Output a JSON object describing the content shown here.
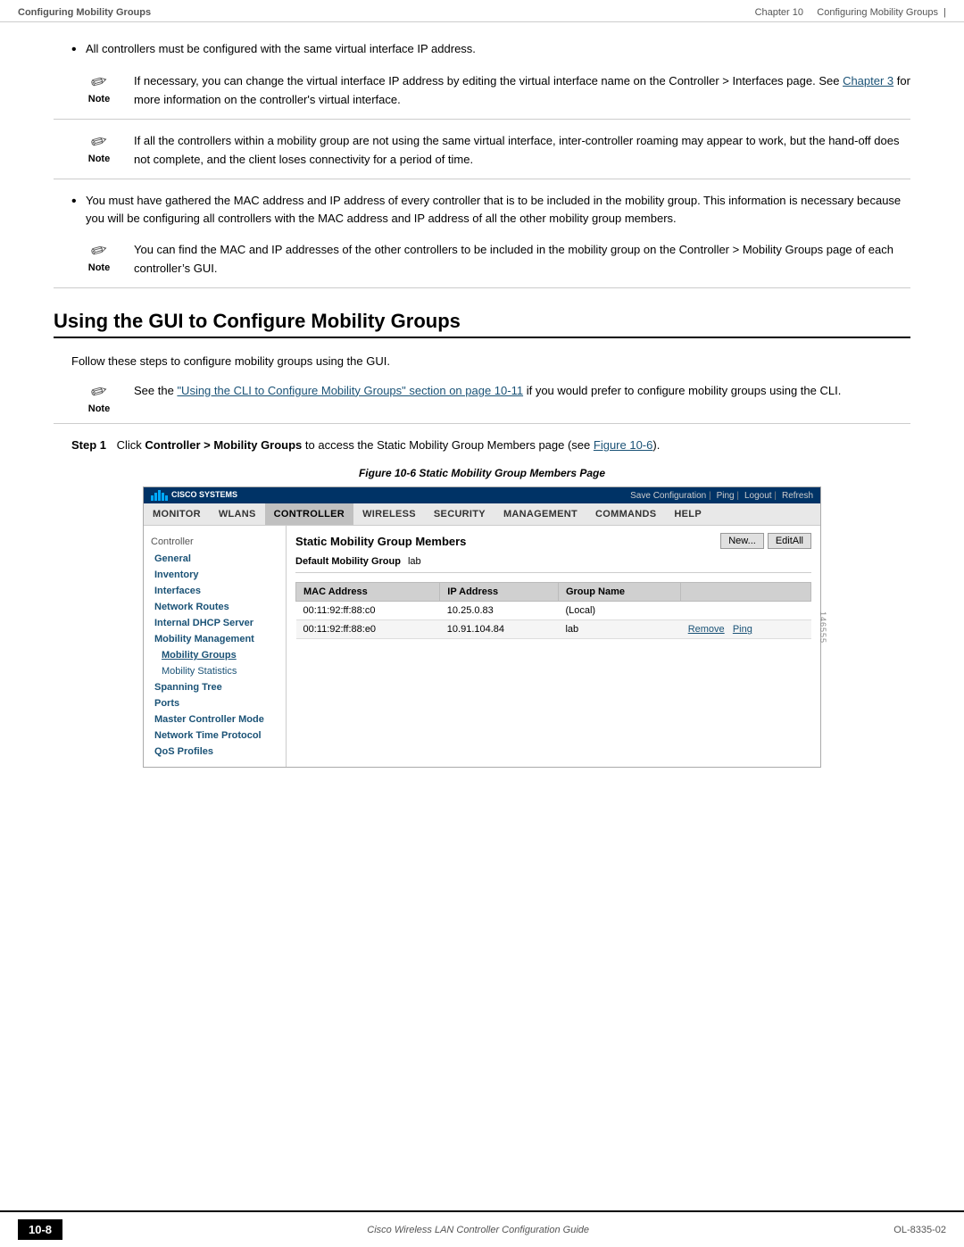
{
  "header": {
    "left_breadcrumb": "Configuring Mobility Groups",
    "right_chapter": "Chapter 10",
    "right_title": "Configuring Mobility Groups"
  },
  "bullets": [
    {
      "text": "All controllers must be configured with the same virtual interface IP address."
    },
    {
      "text": "You must have gathered the MAC address and IP address of every controller that is to be included in the mobility group. This information is necessary because you will be configuring all controllers with the MAC address and IP address of all the other mobility group members."
    }
  ],
  "notes": [
    {
      "id": "note1",
      "label": "Note",
      "text": "If necessary, you can change the virtual interface IP address by editing the virtual interface name on the Controller > Interfaces page. See Chapter 3 for more information on the controller’s virtual interface.",
      "link_text": "Chapter 3",
      "link_href": "#"
    },
    {
      "id": "note2",
      "label": "Note",
      "text": "If all the controllers within a mobility group are not using the same virtual interface, inter-controller roaming may appear to work, but the hand-off does not complete, and the client loses connectivity for a period of time."
    },
    {
      "id": "note3",
      "label": "Note",
      "text": "You can find the MAC and IP addresses of the other controllers to be included in the mobility group on the Controller > Mobility Groups page of each controller’s GUI."
    },
    {
      "id": "note4",
      "label": "Note",
      "text": "See the “Using the CLI to Configure Mobility Groups” section on page 10-11 if you would prefer to configure mobility groups using the CLI.",
      "link_text": "“Using the CLI to Configure Mobility Groups” section on page 10-11",
      "link_href": "#"
    }
  ],
  "section": {
    "heading": "Using the GUI to Configure Mobility Groups",
    "intro": "Follow these steps to configure mobility groups using the GUI."
  },
  "step1": {
    "label": "Step 1",
    "text": "Click Controller > Mobility Groups to access the Static Mobility Group Members page (see Figure 10-6).",
    "bold_text": "Controller > Mobility Groups",
    "link_text": "Figure 10-6",
    "link_href": "#"
  },
  "figure": {
    "caption": "Figure 10-6   Static Mobility Group Members Page",
    "figure_number": "146555"
  },
  "screenshot": {
    "topbar": {
      "logo_line1": "CISCO SYSTEMS",
      "save_config": "Save Configuration",
      "ping": "Ping",
      "logout": "Logout",
      "refresh": "Refresh"
    },
    "navbar": {
      "items": [
        "MONITOR",
        "WLANs",
        "CONTROLLER",
        "WIRELESS",
        "SECURITY",
        "MANAGEMENT",
        "COMMANDS",
        "HELP"
      ],
      "active": "CONTROLLER"
    },
    "sidebar": {
      "header": "Controller",
      "items": [
        {
          "label": "General",
          "type": "link"
        },
        {
          "label": "Inventory",
          "type": "link"
        },
        {
          "label": "Interfaces",
          "type": "link"
        },
        {
          "label": "Network Routes",
          "type": "link"
        },
        {
          "label": "Internal DHCP Server",
          "type": "link"
        },
        {
          "label": "Mobility Management",
          "type": "link"
        },
        {
          "label": "Mobility Groups",
          "type": "sub-active"
        },
        {
          "label": "Mobility Statistics",
          "type": "sub"
        },
        {
          "label": "Spanning Tree",
          "type": "link"
        },
        {
          "label": "Ports",
          "type": "link"
        },
        {
          "label": "Master Controller Mode",
          "type": "link"
        },
        {
          "label": "Network Time Protocol",
          "type": "link"
        },
        {
          "label": "QoS Profiles",
          "type": "link"
        }
      ]
    },
    "content": {
      "title": "Static Mobility Group Members",
      "buttons": [
        "New...",
        "EditAll"
      ],
      "default_group_label": "Default Mobility Group",
      "default_group_value": "lab",
      "table": {
        "headers": [
          "MAC Address",
          "IP Address",
          "Group Name"
        ],
        "rows": [
          {
            "mac": "00:11:92:ff:88:c0",
            "ip": "10.25.0.83",
            "group": "(Local)",
            "actions": []
          },
          {
            "mac": "00:11:92:ff:88:e0",
            "ip": "10.91.104.84",
            "group": "lab",
            "actions": [
              "Remove",
              "Ping"
            ]
          }
        ]
      }
    }
  },
  "footer": {
    "page_number": "10-8",
    "center_text": "Cisco Wireless LAN Controller Configuration Guide",
    "right_text": "OL-8335-02"
  }
}
